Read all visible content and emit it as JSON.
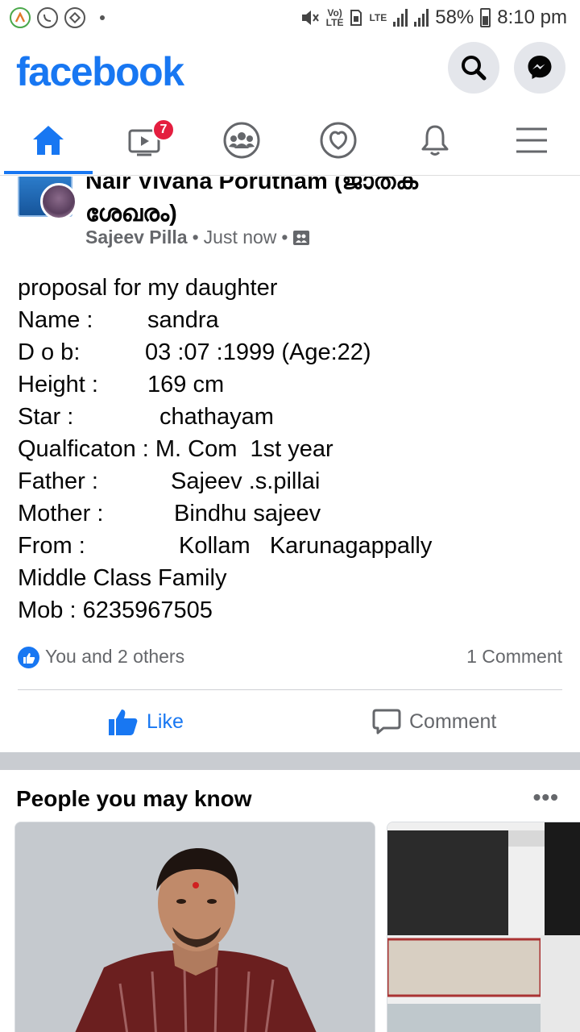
{
  "status_bar": {
    "volte": "Vo)\nLTE",
    "lte": "LTE",
    "battery": "58%",
    "time": "8:10 pm"
  },
  "header": {
    "logo": "facebook",
    "icons": [
      "search-icon",
      "messenger-icon"
    ]
  },
  "tabs": {
    "items": [
      {
        "name": "home",
        "icon": "home-icon",
        "active": true
      },
      {
        "name": "watch",
        "icon": "video-icon",
        "badge": "7"
      },
      {
        "name": "groups",
        "icon": "groups-icon"
      },
      {
        "name": "dating",
        "icon": "heart-icon"
      },
      {
        "name": "notifications",
        "icon": "bell-icon"
      },
      {
        "name": "menu",
        "icon": "hamburger-icon"
      }
    ],
    "accent": "#1877f2"
  },
  "post": {
    "group_name": "Nair Vivaha Porutham (ജാതക ശേഖരം)",
    "author": "Sajeev Pilla",
    "time": "Just now",
    "lines": [
      {
        "label": "proposal for my daughter",
        "value": ""
      },
      {
        "label": "Name :",
        "value": "sandra"
      },
      {
        "label": "D o b:",
        "value": "03 :07 :1999 (Age:22)"
      },
      {
        "label": "Height :",
        "value": "169 cm"
      },
      {
        "label": "Star :",
        "value": "chathayam"
      },
      {
        "label": "Qualficaton : M. Com  1st year",
        "value": ""
      },
      {
        "label": "Father :",
        "value": "Sajeev .s.pillai"
      },
      {
        "label": "Mother :",
        "value": "Bindhu sajeev"
      },
      {
        "label": "From :",
        "value": "Kollam   Karunagappally"
      },
      {
        "label": "Middle Class Family",
        "value": ""
      },
      {
        "label": "Mob : 6235967505",
        "value": ""
      }
    ],
    "reactions_text": "You and 2 others",
    "comments_text": "1 Comment",
    "like_label": "Like",
    "comment_label": "Comment"
  },
  "pymk": {
    "title": "People you may know",
    "more": "•••"
  }
}
